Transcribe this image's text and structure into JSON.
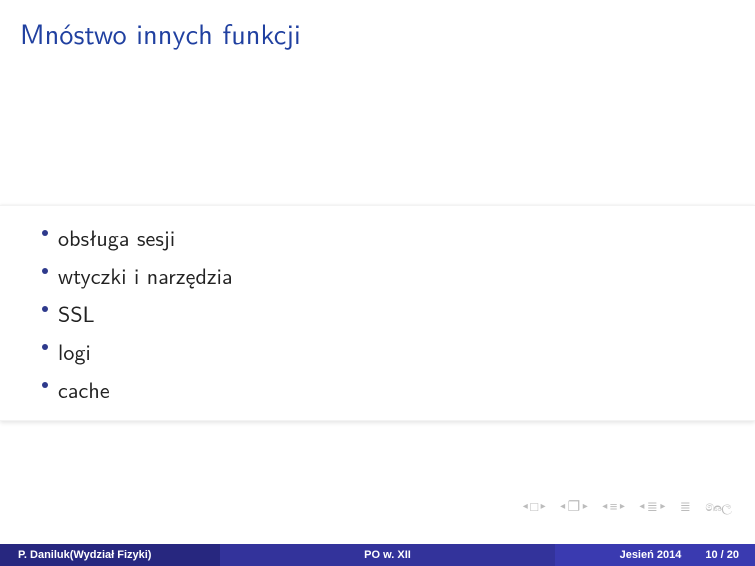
{
  "title": "Mnóstwo innych funkcji",
  "bullets": {
    "b0": "obsługa sesji",
    "b1": "wtyczki i narzędzia",
    "b2": "SSL",
    "b3": "logi",
    "b4": "cache"
  },
  "footer": {
    "author": "P. Daniluk(Wydział Fizyki)",
    "course": "PO w. XII",
    "date": "Jesień 2014",
    "pages": "10 / 20"
  }
}
